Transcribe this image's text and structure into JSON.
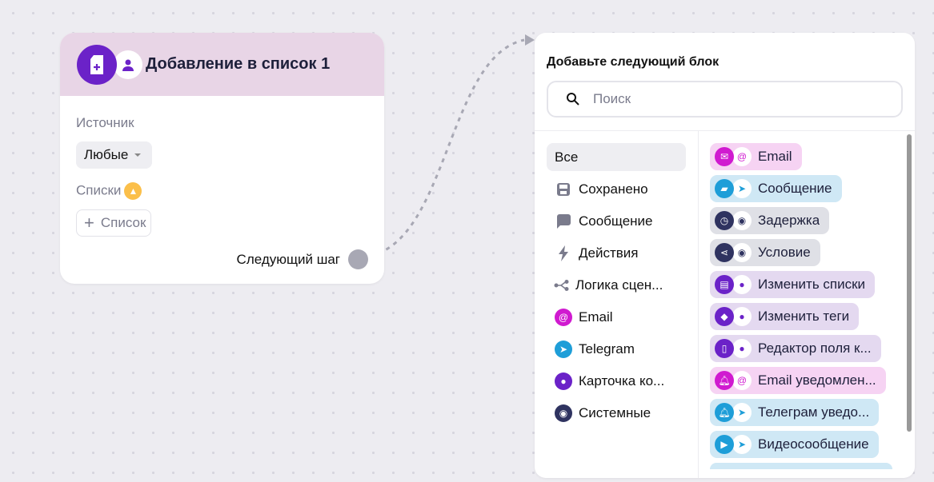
{
  "node": {
    "title": "Добавление в список 1",
    "source_label": "Источник",
    "source_value": "Любые",
    "lists_label": "Списки",
    "add_list": "Список",
    "next_step": "Следующий шаг",
    "plus": "+"
  },
  "panel": {
    "title": "Добавьте следующий блок",
    "search_placeholder": "Поиск",
    "categories": [
      {
        "label": "Все"
      },
      {
        "label": "Сохранено"
      },
      {
        "label": "Сообщение"
      },
      {
        "label": "Действия"
      },
      {
        "label": "Логика сцен..."
      },
      {
        "label": "Email"
      },
      {
        "label": "Telegram"
      },
      {
        "label": "Карточка ко..."
      },
      {
        "label": "Системные"
      }
    ],
    "blocks": [
      {
        "label": "Email"
      },
      {
        "label": "Сообщение"
      },
      {
        "label": "Задержка"
      },
      {
        "label": "Условие"
      },
      {
        "label": "Изменить списки"
      },
      {
        "label": "Изменить теги"
      },
      {
        "label": "Редактор поля к..."
      },
      {
        "label": "Email уведомлен..."
      },
      {
        "label": "Телеграм уведо..."
      },
      {
        "label": "Видеосообщение"
      }
    ]
  },
  "colors": {
    "email": "#d01ad0",
    "telegram": "#1e9ed8",
    "system": "#2f3360",
    "contact": "#6b22c8",
    "email_bg": "#f6d3f3",
    "telegram_bg": "#cfe8f5",
    "system_bg": "#dfe0e6",
    "contact_bg": "#e4d9f0"
  }
}
